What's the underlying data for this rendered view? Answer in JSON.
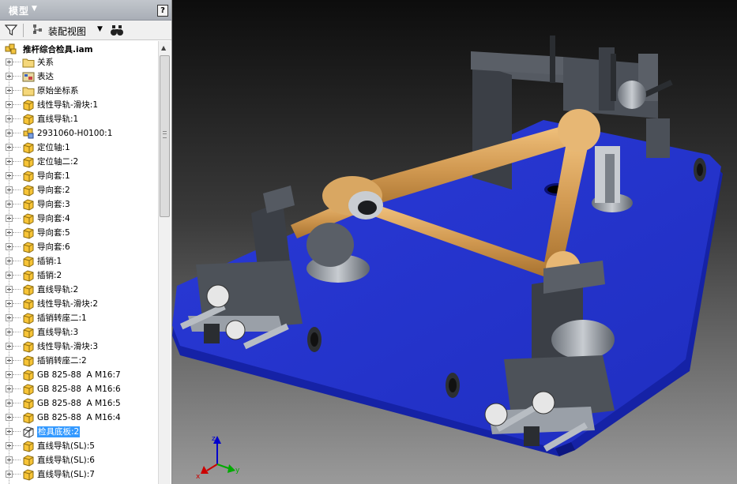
{
  "panel": {
    "title": "模型",
    "help_label": "?",
    "view_label": "装配视图",
    "root_label": "推杆综合检具.iam"
  },
  "tree": {
    "items": [
      {
        "label": "关系",
        "icon": "folder"
      },
      {
        "label": "表达",
        "icon": "representations"
      },
      {
        "label": "原始坐标系",
        "icon": "folder"
      },
      {
        "label": "线性导轨-滑块:1",
        "icon": "part"
      },
      {
        "label": "直线导轨:1",
        "icon": "part"
      },
      {
        "label": "2931060-H0100:1",
        "icon": "subassembly"
      },
      {
        "label": "定位轴:1",
        "icon": "part"
      },
      {
        "label": "定位轴二:2",
        "icon": "part"
      },
      {
        "label": "导向套:1",
        "icon": "part"
      },
      {
        "label": "导向套:2",
        "icon": "part"
      },
      {
        "label": "导向套:3",
        "icon": "part"
      },
      {
        "label": "导向套:4",
        "icon": "part"
      },
      {
        "label": "导向套:5",
        "icon": "part"
      },
      {
        "label": "导向套:6",
        "icon": "part"
      },
      {
        "label": "插销:1",
        "icon": "part"
      },
      {
        "label": "插销:2",
        "icon": "part"
      },
      {
        "label": "直线导轨:2",
        "icon": "part"
      },
      {
        "label": "线性导轨-滑块:2",
        "icon": "part"
      },
      {
        "label": "插销转座二:1",
        "icon": "part"
      },
      {
        "label": "直线导轨:3",
        "icon": "part"
      },
      {
        "label": "线性导轨-滑块:3",
        "icon": "part"
      },
      {
        "label": "插销转座二:2",
        "icon": "part"
      },
      {
        "label": "GB 825-88  A M16:7",
        "icon": "part"
      },
      {
        "label": "GB 825-88  A M16:6",
        "icon": "part"
      },
      {
        "label": "GB 825-88  A M16:5",
        "icon": "part"
      },
      {
        "label": "GB 825-88  A M16:4",
        "icon": "part"
      },
      {
        "label": "检具底板:2",
        "icon": "part-selected",
        "selected": true
      },
      {
        "label": "直线导轨(SL):5",
        "icon": "part"
      },
      {
        "label": "直线导轨(SL):6",
        "icon": "part"
      },
      {
        "label": "直线导轨(SL):7",
        "icon": "part"
      }
    ]
  },
  "colors": {
    "base_plate": "#2233cc",
    "selection": "#3399ff",
    "wood_links": "#d6a15a",
    "metal_parts": "#4d5259",
    "axis_x": "#cc0000",
    "axis_y": "#00aa00",
    "axis_z": "#0000cc"
  }
}
